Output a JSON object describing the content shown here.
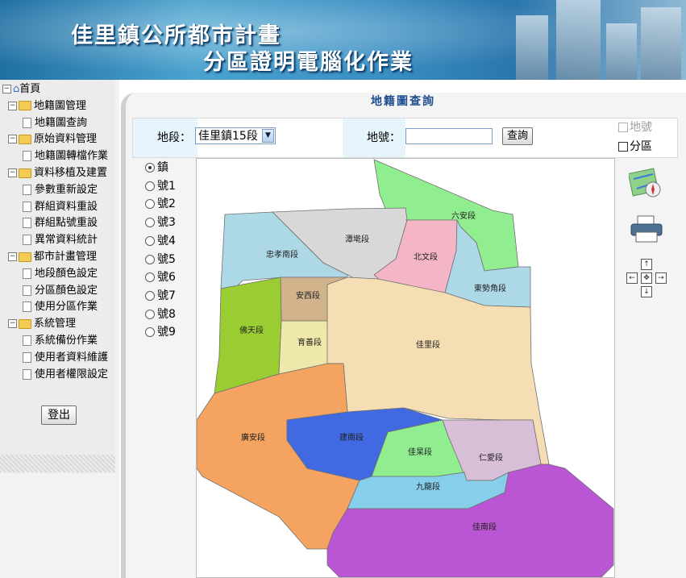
{
  "banner": {
    "line1": "佳里鎮公所都市計畫",
    "line2": "分區證明電腦化作業"
  },
  "sidebar": {
    "root": "首頁",
    "groups": [
      {
        "label": "地籍圖管理",
        "items": [
          "地籍圖查詢"
        ]
      },
      {
        "label": "原始資料管理",
        "items": [
          "地籍圖轉檔作業"
        ]
      },
      {
        "label": "資料移植及建置",
        "items": [
          "參數重新設定",
          "群組資料重設",
          "群組點號重設",
          "異常資料統計"
        ]
      },
      {
        "label": "都市計畫管理",
        "items": [
          "地段顏色設定",
          "分區顏色設定",
          "使用分區作業"
        ]
      },
      {
        "label": "系統管理",
        "items": [
          "系統備份作業",
          "使用者資料維護",
          "使用者權限設定"
        ]
      }
    ],
    "logout_label": "登出"
  },
  "page": {
    "title": "地籍圖查詢"
  },
  "query": {
    "section_label": "地段：",
    "section_value": "佳里鎮15段",
    "landno_label": "地號：",
    "landno_value": "",
    "search_label": "查詢",
    "chk_landno": "地號",
    "chk_zone": "分區"
  },
  "radios": {
    "selected": "鎮",
    "options": [
      "鎮",
      "號1",
      "號2",
      "號3",
      "號4",
      "號5",
      "號6",
      "號7",
      "號8",
      "號9"
    ]
  },
  "map": {
    "regions": [
      {
        "name": "六安段",
        "color": "#90ee90"
      },
      {
        "name": "潭墘段",
        "color": "#d8d8d8"
      },
      {
        "name": "忠孝南段",
        "color": "#add8e6"
      },
      {
        "name": "北文段",
        "color": "#f4b6c6"
      },
      {
        "name": "東勢角段",
        "color": "#add8e6"
      },
      {
        "name": "安西段",
        "color": "#d2b48c"
      },
      {
        "name": "佛天段",
        "color": "#9acd32"
      },
      {
        "name": "育善段",
        "color": "#eee8aa"
      },
      {
        "name": "佳里段",
        "color": "#f5deb3"
      },
      {
        "name": "廣安段",
        "color": "#f4a460"
      },
      {
        "name": "建南段",
        "color": "#4169e1"
      },
      {
        "name": "佳杲段",
        "color": "#90ee90"
      },
      {
        "name": "仁愛段",
        "color": "#d8bfd8"
      },
      {
        "name": "九龍段",
        "color": "#87ceeb"
      },
      {
        "name": "佳南段",
        "color": "#ba55d3"
      }
    ]
  },
  "tools": {
    "map_icon": "map-compass-icon",
    "print_icon": "printer-icon",
    "pan_up": "↑",
    "pan_down": "↓",
    "pan_left": "←",
    "pan_right": "→",
    "pan_center": "✥"
  }
}
